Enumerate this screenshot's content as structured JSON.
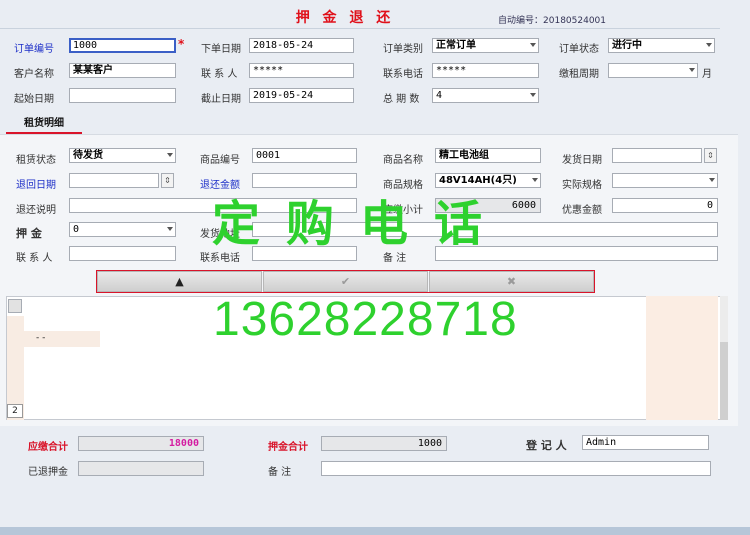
{
  "header": {
    "title": "押 金 退 还",
    "auto_label": "自动编号：",
    "auto_value": "20180524001"
  },
  "order": {
    "order_no_label": "订单编号",
    "order_no": "1000",
    "order_date_label": "下单日期",
    "order_date": "2018-05-24",
    "order_type_label": "订单类别",
    "order_type": "正常订单",
    "order_status_label": "订单状态",
    "order_status": "进行中",
    "customer_label": "客户名称",
    "customer": "某某客户",
    "contact_label": "联 系 人",
    "contact": "*****",
    "phone_label": "联系电话",
    "phone": "*****",
    "rent_period_label": "缴租周期",
    "rent_period": "",
    "month_unit": "月",
    "start_label": "起始日期",
    "start": "",
    "end_label": "截止日期",
    "end": "2019-05-24",
    "periods_label": "总 期 数",
    "periods": "4"
  },
  "tabs": [
    {
      "label": "租货明细"
    }
  ],
  "detail": {
    "rent_status_label": "租赁状态",
    "rent_status": "待发货",
    "product_no_label": "商品编号",
    "product_no": "0001",
    "product_name_label": "商品名称",
    "product_name": "精工电池组",
    "ship_date_label": "发货日期",
    "ship_date": "",
    "return_date_label": "退回日期",
    "return_date": "",
    "return_amount_label": "退还金额",
    "return_amount": "",
    "spec_label": "商品规格",
    "spec": "48V14AH(4只)",
    "actual_spec_label": "实际规格",
    "actual_spec": "",
    "return_note_label": "退还说明",
    "return_note": "",
    "subtotal_label": "应缴小计",
    "subtotal": "6000",
    "discount_label": "优惠金额",
    "discount": "0",
    "deposit_label": "押   金",
    "deposit": "0",
    "ship_addr_label": "发货地址",
    "ship_addr": "",
    "contact_label": "联 系 人",
    "contact": "",
    "phone_label": "联系电话",
    "phone": "",
    "remark_label": "备   注",
    "remark": ""
  },
  "toolbar": {
    "up_label": "▲",
    "confirm_label": "✔",
    "cancel_label": "✖"
  },
  "grid": {
    "row_text": "- -",
    "page_no": "2"
  },
  "watermark": {
    "line1": "定购电话",
    "line2": "13628228718"
  },
  "summary": {
    "due_total_label": "应缴合计",
    "due_total": "18000",
    "deposit_total_label": "押金合计",
    "deposit_total": "1000",
    "registrar_label": "登 记 人",
    "registrar": "Admin",
    "refunded_label": "已退押金",
    "refunded": "",
    "remark_label": "备   注",
    "remark": ""
  }
}
